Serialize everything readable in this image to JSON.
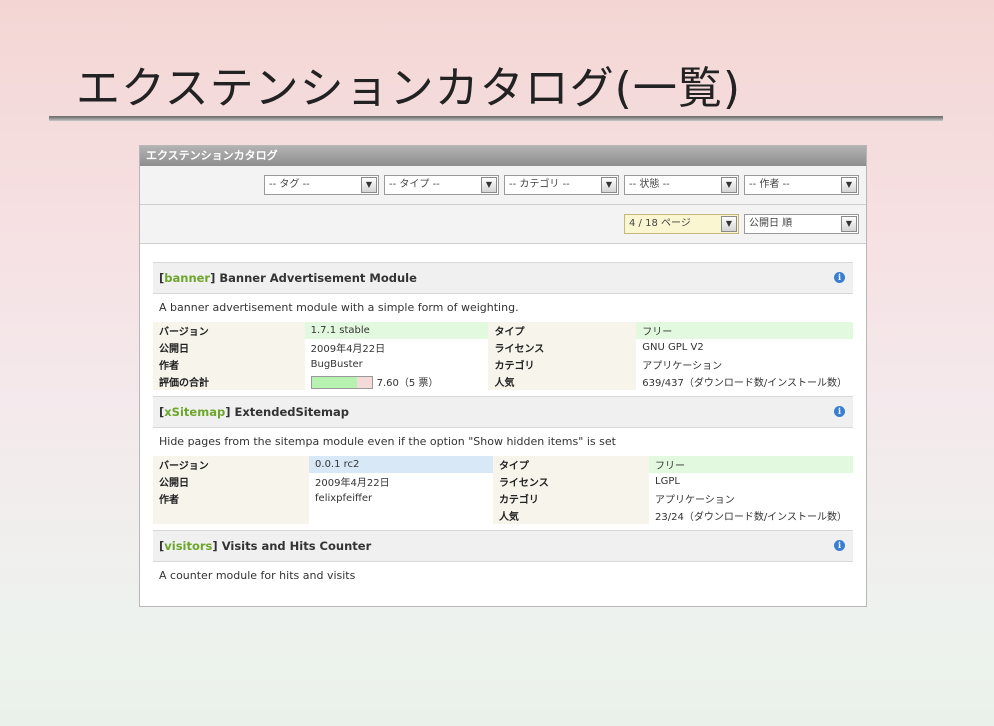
{
  "slide": {
    "title": "エクステンションカタログ(一覧)"
  },
  "panel": {
    "header": "エクステンションカタログ",
    "filters": [
      "-- タグ --",
      "-- タイプ --",
      "-- カテゴリ --",
      "-- 状態 --",
      "-- 作者 --"
    ],
    "pager": {
      "page": "4 / 18 ページ",
      "sort": "公開日 順"
    }
  },
  "labels": {
    "version": "バージョン",
    "type": "タイプ",
    "date": "公開日",
    "license": "ライセンス",
    "author": "作者",
    "category": "カテゴリ",
    "rating": "評価の合計",
    "popularity": "人気"
  },
  "modules": [
    {
      "tag": "banner",
      "name": "Banner Advertisement Module",
      "description": "A banner advertisement module with a simple form of weighting.",
      "version": "1.7.1 stable",
      "type": "フリー",
      "date": "2009年4月22日",
      "license": "GNU GPL V2",
      "author": "BugBuster",
      "category": "アプリケーション",
      "rating_text": "7.60（5 票）",
      "rating_fraction": 0.76,
      "popularity": "639/437（ダウンロード数/インストール数）"
    },
    {
      "tag": "xSitemap",
      "name": "ExtendedSitemap",
      "description": "Hide pages from the sitempa module even if the option \"Show hidden items\" is set",
      "version": "0.0.1 rc2",
      "type": "フリー",
      "date": "2009年4月22日",
      "license": "LGPL",
      "author": "felixpfeiffer",
      "category": "アプリケーション",
      "popularity": "23/24（ダウンロード数/インストール数）"
    },
    {
      "tag": "visitors",
      "name": "Visits and Hits Counter",
      "description": "A counter module for hits and visits"
    }
  ],
  "brackets": {
    "open": "[",
    "close": "]"
  },
  "icons": {
    "dropdown": "chevron-down-icon",
    "info": "info-icon"
  },
  "colors": {
    "tag": "#6da62c",
    "info": "#3a7fd0"
  }
}
